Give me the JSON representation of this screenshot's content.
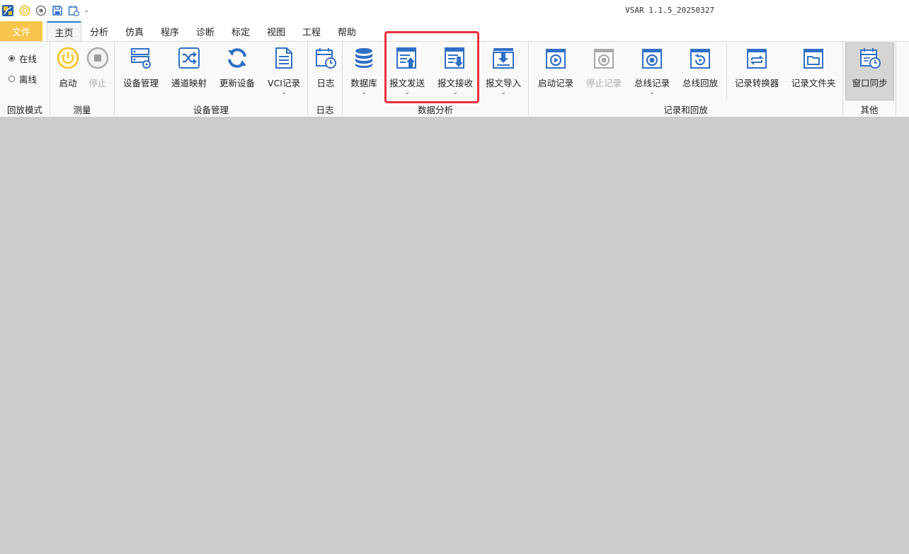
{
  "window": {
    "title": "VSAR 1.1.5_20250327"
  },
  "quick_access": [
    {
      "icon": "app-logo-icon"
    },
    {
      "icon": "start-icon"
    },
    {
      "icon": "stop-icon"
    },
    {
      "icon": "save-icon"
    },
    {
      "icon": "calendar-icon"
    },
    {
      "icon": "customize-dropdown-icon"
    }
  ],
  "menu": {
    "file": "文件",
    "tabs": [
      "主页",
      "分析",
      "仿真",
      "程序",
      "诊断",
      "标定",
      "视图",
      "工程",
      "帮助"
    ],
    "active": "主页"
  },
  "ribbon": {
    "playback_mode": {
      "label": "回放模式",
      "options": [
        "在线",
        "离线"
      ],
      "selected": "在线"
    },
    "measure": {
      "label": "测量",
      "buttons": [
        {
          "label": "启动",
          "icon": "power-icon",
          "enabled": true
        },
        {
          "label": "停止",
          "icon": "stop-circle-icon",
          "enabled": false
        }
      ]
    },
    "device_mgmt": {
      "label": "设备管理",
      "buttons": [
        {
          "label": "设备管理",
          "icon": "device-settings-icon"
        },
        {
          "label": "通道映射",
          "icon": "shuffle-icon"
        },
        {
          "label": "更新设备",
          "icon": "refresh-icon"
        },
        {
          "label": "VCI记录",
          "icon": "document-icon",
          "dropdown": true
        }
      ]
    },
    "log": {
      "label": "日志",
      "buttons": [
        {
          "label": "日志",
          "icon": "calendar-clock-icon"
        }
      ]
    },
    "data_analysis": {
      "label": "数据分析",
      "buttons": [
        {
          "label": "数据库",
          "icon": "database-icon",
          "dropdown": true
        },
        {
          "label": "报文发送",
          "icon": "message-send-icon",
          "dropdown": true
        },
        {
          "label": "报文接收",
          "icon": "message-receive-icon",
          "dropdown": true
        },
        {
          "label": "报文导入",
          "icon": "message-import-icon",
          "dropdown": true
        }
      ]
    },
    "record_playback": {
      "label": "记录和回放",
      "buttons": [
        {
          "label": "启动记录",
          "icon": "record-start-icon",
          "enabled": true
        },
        {
          "label": "停止记录",
          "icon": "record-stop-icon",
          "enabled": false
        },
        {
          "label": "总线记录",
          "icon": "bus-record-icon",
          "dropdown": true
        },
        {
          "label": "总线回放",
          "icon": "bus-playback-icon"
        },
        {
          "label": "记录转换器",
          "icon": "record-converter-icon"
        },
        {
          "label": "记录文件夹",
          "icon": "record-folder-icon"
        }
      ]
    },
    "other": {
      "label": "其他",
      "buttons": [
        {
          "label": "窗口同步",
          "icon": "window-sync-icon",
          "selected": true
        }
      ]
    }
  },
  "colors": {
    "accent_blue": "#2f6fc6",
    "file_tab": "#f7c54b",
    "start_yellow": "#f2c12e",
    "highlight_red": "#e8323c",
    "workspace": "#cccccc"
  }
}
